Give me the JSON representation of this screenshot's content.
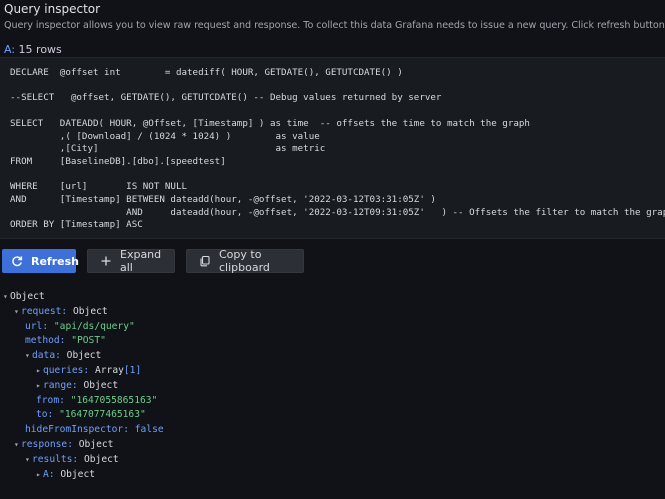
{
  "header": {
    "title": "Query inspector",
    "description": "Query inspector allows you to view raw request and response. To collect this data Grafana needs to issue a new query. Click refresh button below to trigger a new query.",
    "query_label": "A:",
    "rows_text": "15 rows"
  },
  "sql": "DECLARE  @offset int        = datediff( HOUR, GETDATE(), GETUTCDATE() )\n\n--SELECT   @offset, GETDATE(), GETUTCDATE() -- Debug values returned by server\n\nSELECT   DATEADD( HOUR, @Offset, [Timestamp] ) as time  -- offsets the time to match the graph\n         ,( [Download] / (1024 * 1024) )        as value\n         ,[City]                                as metric\nFROM     [BaselineDB].[dbo].[speedtest]\n\nWHERE    [url]       IS NOT NULL\nAND      [Timestamp] BETWEEN dateadd(hour, -@offset, '2022-03-12T03:31:05Z' )\n                     AND     dateadd(hour, -@offset, '2022-03-12T09:31:05Z'   ) -- Offsets the filter to match the graph\nORDER BY [Timestamp] ASC",
  "toolbar": {
    "refresh_label": "Refresh",
    "expand_label": "Expand all",
    "copy_label": "Copy to clipboard"
  },
  "tree": {
    "root": "Object",
    "request_key": "request:",
    "request_val": "Object",
    "url_key": "url:",
    "url_val": "\"api/ds/query\"",
    "method_key": "method:",
    "method_val": "\"POST\"",
    "data_key": "data:",
    "data_val": "Object",
    "queries_key": "queries:",
    "queries_val": "Array",
    "queries_count": "[1]",
    "range_key": "range:",
    "range_val": "Object",
    "from_key": "from:",
    "from_val": "\"1647055865163\"",
    "to_key": "to:",
    "to_val": "\"1647077465163\"",
    "hide_key": "hideFromInspector:",
    "hide_val": "false",
    "response_key": "response:",
    "response_val": "Object",
    "results_key": "results:",
    "results_val": "Object",
    "a_key": "A:",
    "a_val": "Object"
  },
  "icons": {
    "refresh": "refresh-icon",
    "expand": "plus-icon",
    "copy": "copy-icon"
  },
  "colors": {
    "background": "#111217",
    "primary_button": "#3d71d9",
    "key": "#6e9fff",
    "string": "#6ccf8e"
  }
}
